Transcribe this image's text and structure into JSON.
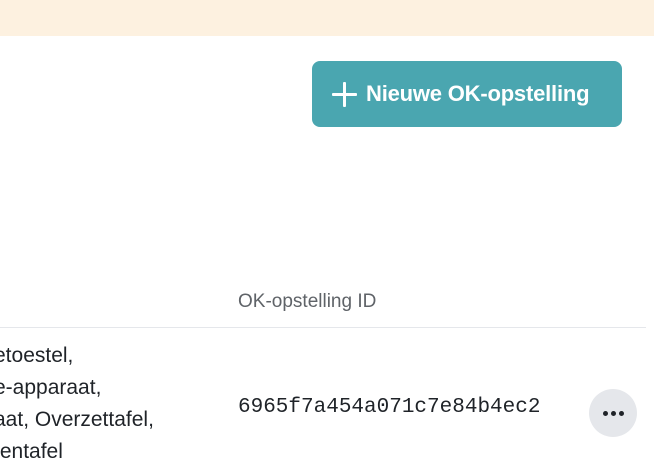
{
  "banner": {
    "color": "#fdf1e0"
  },
  "toolbar": {
    "new_button_label": "Nieuwe OK-opstelling",
    "new_button_icon": "plus-icon",
    "accent_color": "#4aa6b0"
  },
  "table": {
    "columns": {
      "id_header": "OK-opstelling ID"
    },
    "rows": [
      {
        "equipment_lines": [
          "etoestel,",
          "e-apparaat,",
          "aat, Overzettafel,",
          "tentafel"
        ],
        "id": "6965f7a454a071c7e84b4ec2",
        "actions_icon": "more-horizontal-icon"
      }
    ]
  }
}
